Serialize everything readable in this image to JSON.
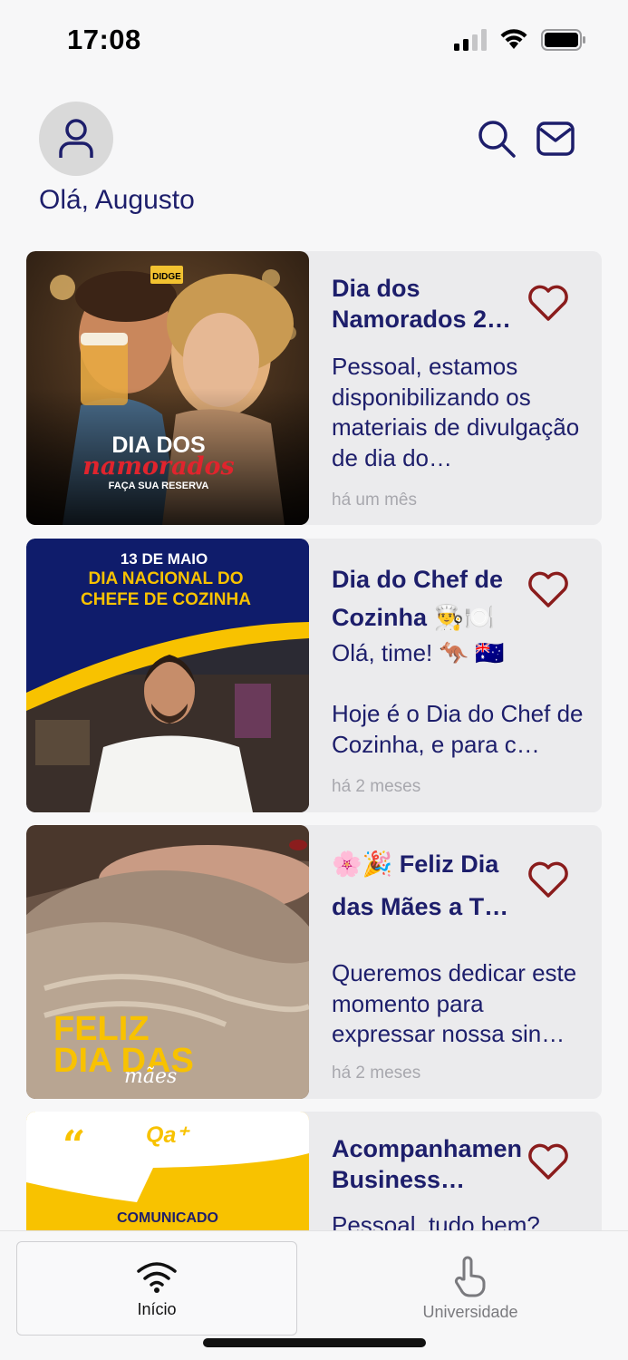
{
  "status": {
    "time": "17:08"
  },
  "header": {
    "greeting": "Olá, Augusto",
    "search_icon": "search-icon",
    "mail_icon": "mail-icon"
  },
  "posts": [
    {
      "title": "Dia dos Namorados 2…",
      "body": "Pessoal, estamos disponibilizando os materiais de divulgação de dia do…",
      "time": "há um mês",
      "image": {
        "brand": "DIDGE",
        "line1": "DIA DOS",
        "line2": "namorados",
        "line3": "FAÇA SUA RESERVA"
      }
    },
    {
      "title": "Dia do Chef de Cozinha 👨‍🍳🍽️",
      "body": "Olá, time! 🦘 🇦🇺\n\nHoje é o Dia do Chef de Cozinha, e para c…",
      "time": "há 2 meses",
      "image": {
        "line1": "13 DE MAIO",
        "line2": "DIA NACIONAL DO",
        "line3": "CHEFE DE COZINHA"
      }
    },
    {
      "title": "🌸🎉 Feliz Dia das Mães a T…",
      "body": "Queremos dedicar este momento para expressar nossa sin…",
      "time": "há 2 meses",
      "image": {
        "line1": "FELIZ",
        "line2": "DIA DAS",
        "line3": "mães"
      }
    },
    {
      "title": "Acompanhamento Business…",
      "body": "Pessoal, tudo bem?",
      "time": "",
      "image": {
        "quote": "“",
        "logo": "Qa⁺",
        "label": "COMUNICADO"
      }
    }
  ],
  "tabbar": {
    "tabs": [
      {
        "label": "Início",
        "icon": "wifi-icon",
        "active": true
      },
      {
        "label": "Universidade",
        "icon": "pointer-hand-icon",
        "active": false
      }
    ]
  },
  "colors": {
    "navy": "#1d1e6b",
    "heart": "#8a1c1c",
    "card_bg": "#ebebed",
    "muted": "#a8a8ae",
    "yellow": "#f8c200"
  }
}
